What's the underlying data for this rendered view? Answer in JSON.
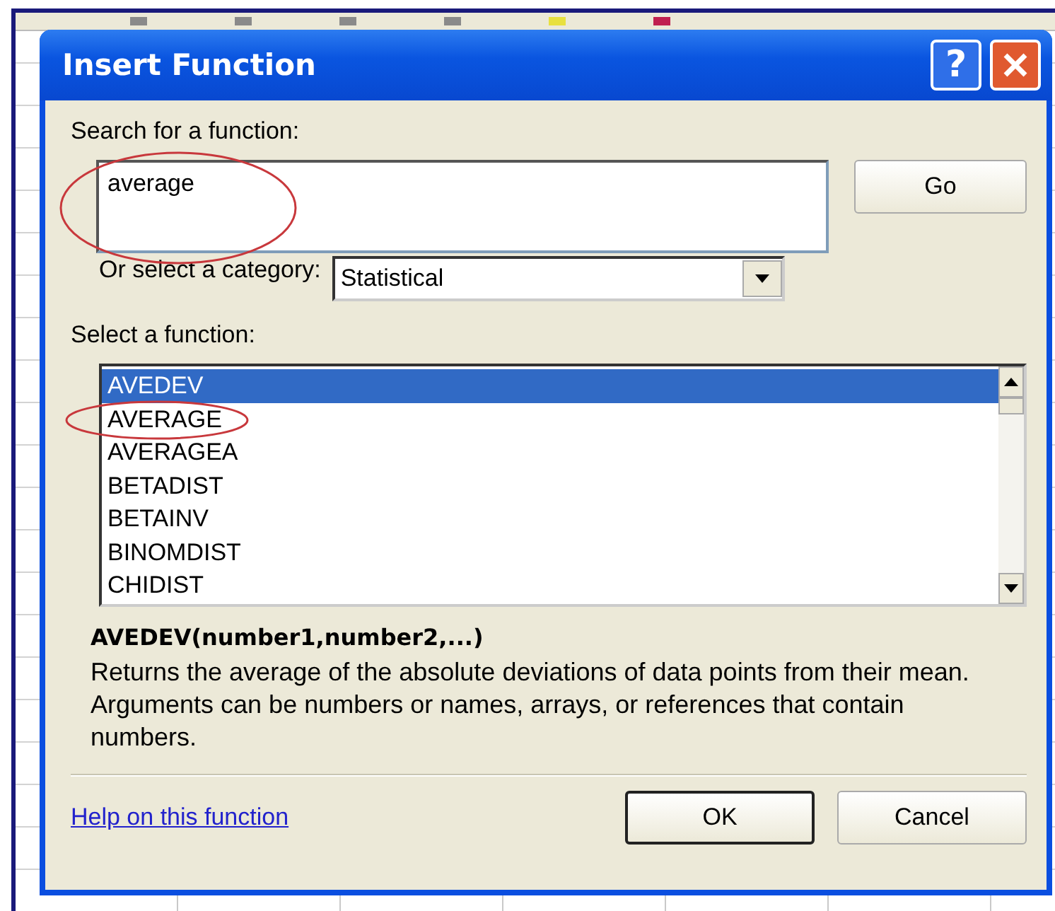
{
  "window": {
    "title": "Insert Function",
    "help": "?"
  },
  "search": {
    "label": "Search for a function:",
    "value": "average",
    "circled": true
  },
  "go_button": "Go",
  "category": {
    "label": "Or select a category:",
    "value": "Statistical"
  },
  "function_list": {
    "label": "Select a function:",
    "items": [
      {
        "name": "AVEDEV",
        "selected": true,
        "circled": false
      },
      {
        "name": "AVERAGE",
        "selected": false,
        "circled": true
      },
      {
        "name": "AVERAGEA",
        "selected": false,
        "circled": false
      },
      {
        "name": "BETADIST",
        "selected": false,
        "circled": false
      },
      {
        "name": "BETAINV",
        "selected": false,
        "circled": false
      },
      {
        "name": "BINOMDIST",
        "selected": false,
        "circled": false
      },
      {
        "name": "CHIDIST",
        "selected": false,
        "circled": false
      }
    ]
  },
  "signature": "AVEDEV(number1,number2,...)",
  "description": "Returns the average of the absolute deviations of data points from their mean. Arguments can be numbers or names, arrays, or references that contain numbers.",
  "help_link": "Help on this function",
  "buttons": [
    {
      "label": "OK",
      "default": true
    },
    {
      "label": "Cancel",
      "default": false
    }
  ]
}
